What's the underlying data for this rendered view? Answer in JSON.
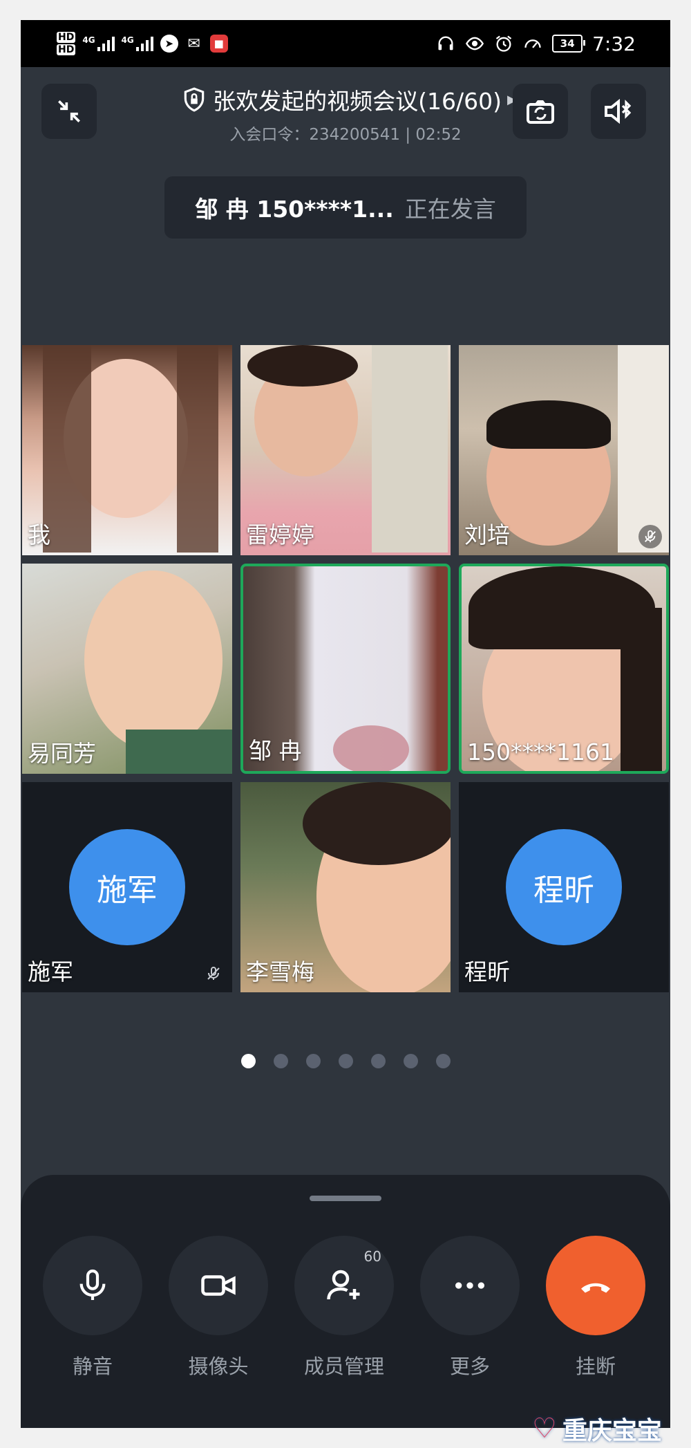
{
  "status_bar": {
    "hd1": "HD",
    "hd2": "HD",
    "net1": "4G",
    "net2": "4G",
    "battery": "34",
    "time": "7:32",
    "icons": [
      "headset-icon",
      "eye-icon",
      "alarm-icon",
      "speedometer-icon"
    ]
  },
  "header": {
    "title": "张欢发起的视频会议(16/60)",
    "code_line": "入会口令：234200541 | 02:52"
  },
  "speaking": {
    "who": "邹 冉 150****1...",
    "state": "正在发言"
  },
  "participants": [
    {
      "name": "我",
      "muted": false,
      "active": false,
      "video": true
    },
    {
      "name": "雷婷婷",
      "muted": false,
      "active": false,
      "video": true
    },
    {
      "name": "刘培",
      "muted": true,
      "active": false,
      "video": true
    },
    {
      "name": "易同芳",
      "muted": false,
      "active": false,
      "video": true
    },
    {
      "name": "邹 冉",
      "muted": false,
      "active": true,
      "video": true
    },
    {
      "name": "150****1161",
      "muted": false,
      "active": true,
      "video": true
    },
    {
      "name": "施军",
      "avatar": "施军",
      "muted": true,
      "active": false,
      "video": false
    },
    {
      "name": "李雪梅",
      "muted": false,
      "active": false,
      "video": true
    },
    {
      "name": "程昕",
      "avatar": "程昕",
      "muted": false,
      "active": false,
      "video": false
    }
  ],
  "pager": {
    "pages": 7,
    "current": 1
  },
  "controls": {
    "mute": "静音",
    "camera": "摄像头",
    "members": "成员管理",
    "members_badge": "60",
    "more": "更多",
    "hangup": "挂断"
  },
  "colors": {
    "accent": "#3e90ec",
    "active_border": "#1ea85a",
    "hangup": "#f0602e"
  },
  "watermark": "重庆宝宝"
}
